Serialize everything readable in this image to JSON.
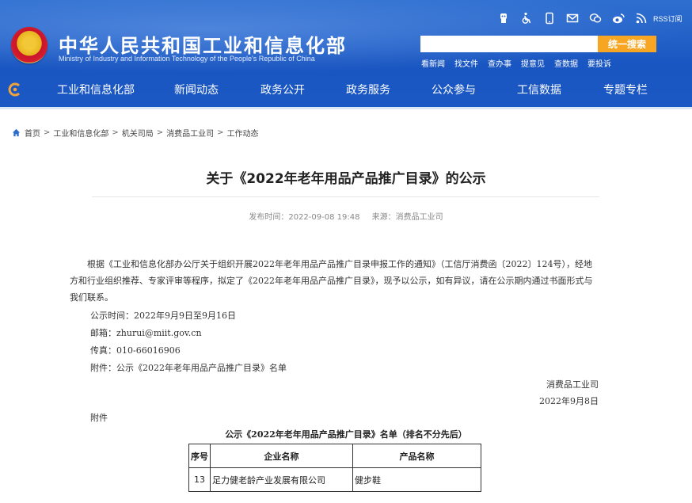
{
  "header": {
    "site_title": "中华人民共和国工业和信息化部",
    "site_subtitle": "Ministry of Industry and Information Technology of the People's Republic of China",
    "rss_label": "RSS订阅",
    "search": {
      "placeholder": "",
      "button_label": "统一搜索"
    },
    "quick_links": [
      "看新闻",
      "找文件",
      "查办事",
      "提意见",
      "查数据",
      "要投诉"
    ],
    "icons": [
      "robot-icon",
      "accessibility-icon",
      "mobile-icon",
      "mail-icon",
      "wechat-icon",
      "weibo-icon",
      "rss-icon"
    ]
  },
  "nav": {
    "items": [
      "工业和信息化部",
      "新闻动态",
      "政务公开",
      "政务服务",
      "公众参与",
      "工信数据",
      "专题专栏"
    ]
  },
  "breadcrumb": [
    "首页",
    "工业和信息化部",
    "机关司局",
    "消费品工业司",
    "工作动态"
  ],
  "article": {
    "title": "关于《2022年老年用品产品推广目录》的公示",
    "publish_time": "发布时间：2022-09-08 19:48",
    "source": "来源：消费品工业司",
    "paragraph": "根据《工业和信息化部办公厅关于组织开展2022年老年用品产品推广目录申报工作的通知》（工信厅消费函〔2022〕124号），经地方和行业组织推荐、专家评审等程序，拟定了《2022年老年用品产品推广目录》，现予以公示，如有异议，请在公示期内通过书面形式与我们联系。",
    "notice_period": "公示时间：2022年9月9日至9月16日",
    "email": "邮箱：zhurui@miit.gov.cn",
    "fax": "传真：010-66016906",
    "attachment_line": "附件：公示《2022年老年用品产品推广目录》名单",
    "signature_dept": "消费品工业司",
    "signature_date": "2022年9月8日",
    "attachment_heading": "附件",
    "table_caption": "公示《2022年老年用品产品推广目录》名单（排名不分先后）",
    "table": {
      "headers": [
        "序号",
        "企业名称",
        "产品名称"
      ],
      "rows": [
        [
          "13",
          "足力健老龄产业发展有限公司",
          "健步鞋"
        ]
      ]
    }
  },
  "colors": {
    "header_blue": "#1a56c1",
    "search_button": "#f6a623",
    "nav_home_icon": "#f2a33a"
  }
}
